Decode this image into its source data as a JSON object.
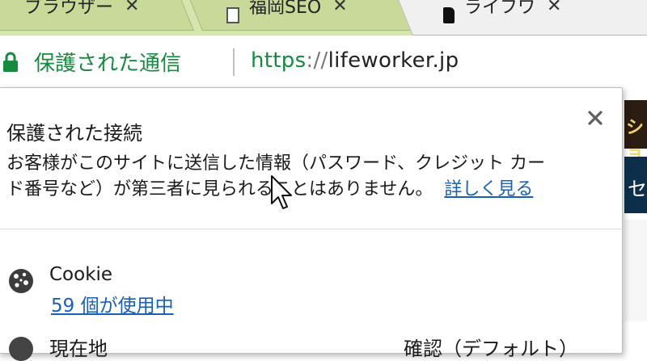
{
  "tabs": [
    {
      "title": "ブラウザー",
      "active": false
    },
    {
      "title": "福岡SEO",
      "active": false
    },
    {
      "title": "ライフワ",
      "active": true
    }
  ],
  "omnibox": {
    "security_label": "保護された通信",
    "url_scheme": "https",
    "url_separator": "://",
    "url_host": "lifeworker.jp"
  },
  "popup": {
    "title": "保護された接続",
    "description_line1": "お客様がこのサイトに送信した情報（パスワード、クレジット カー",
    "description_line2": "ド番号など）が第三者に見られることはありません。",
    "learn_more": "詳しく見る",
    "cookie": {
      "label": "Cookie",
      "count_link": "59 個が使用中"
    },
    "location": {
      "label": "現在地",
      "value": "確認（デフォルト）"
    }
  },
  "background_page": {
    "strip1_text": "ショ",
    "strip2_text": "セ"
  },
  "colors": {
    "secure_green": "#168a3f",
    "link_blue": "#1b5fb4",
    "tabstrip": "#d6e4ad",
    "active_tab": "#f0f0f0"
  },
  "icons": {
    "lock": "lock-icon",
    "close": "close-icon",
    "cookie": "cookie-icon",
    "location": "location-icon"
  }
}
